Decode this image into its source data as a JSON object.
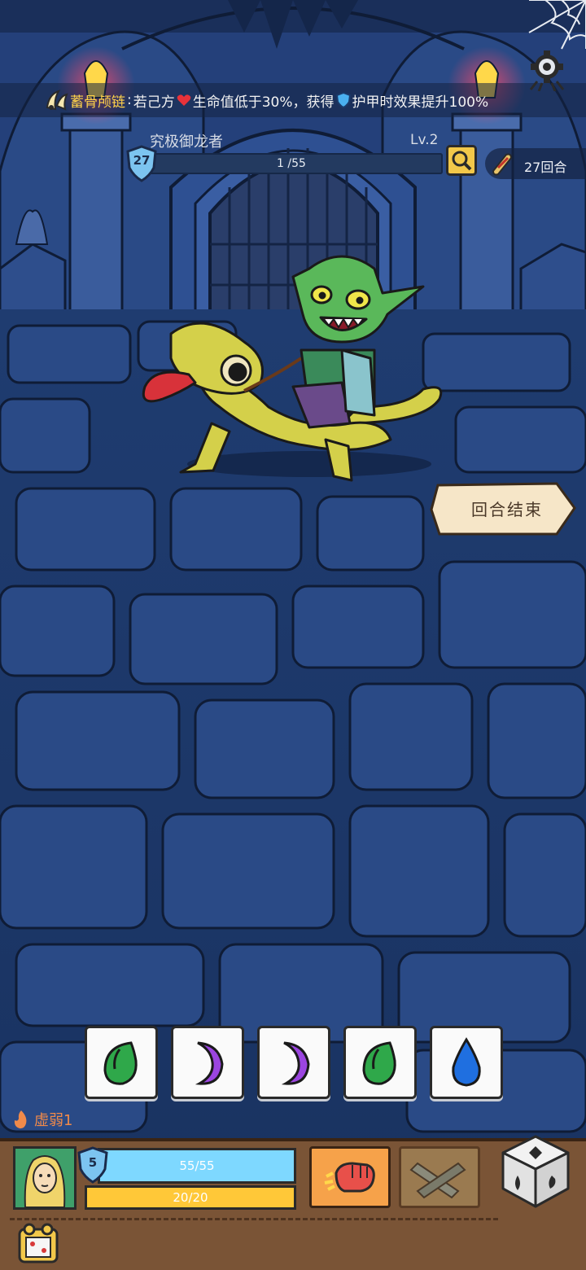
{
  "relic": {
    "name": "蓄骨颅链",
    "colon": ":",
    "text_a": "若己方",
    "text_b": "生命值低于30%，获得",
    "text_c": "护甲时效果提升100%",
    "icon": "bone-skull-chain-icon"
  },
  "enemy": {
    "name": "究极御龙者",
    "level": "Lv.2",
    "armor": "27",
    "hp_text": "1 /55",
    "hp_current": 1,
    "hp_max": 55
  },
  "turn": {
    "label": "27回合",
    "icon": "scroll-icon"
  },
  "end_turn": {
    "label": "回合结束"
  },
  "dice_slots": [
    {
      "icon": "leaf-icon",
      "color": "#2fa84a"
    },
    {
      "icon": "moon-icon",
      "color": "#9b45e0"
    },
    {
      "icon": "moon-icon",
      "color": "#9b45e0"
    },
    {
      "icon": "leaf-icon",
      "color": "#2fa84a"
    },
    {
      "icon": "drop-icon",
      "color": "#1f6fe0"
    }
  ],
  "debuff": {
    "label": "虚弱1",
    "icon": "flame-icon"
  },
  "player": {
    "armor": "5",
    "hp_text": "55/55",
    "energy_text": "20/20"
  },
  "colors": {
    "hp": "#7ed8ff",
    "energy": "#ffc838",
    "gold": "#ffd24a"
  }
}
